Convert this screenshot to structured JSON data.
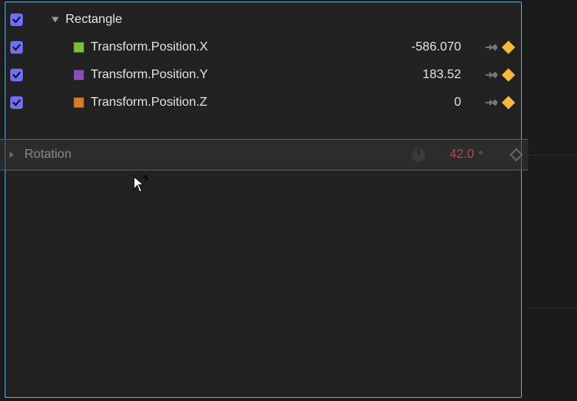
{
  "panel": {
    "group_label": "Rectangle",
    "rows": [
      {
        "swatch": "#75c13c",
        "label": "Transform.Position.X",
        "value": "-586.070"
      },
      {
        "swatch": "#8a4fb3",
        "label": "Transform.Position.Y",
        "value": "183.52"
      },
      {
        "swatch": "#d67b2c",
        "label": "Transform.Position.Z",
        "value": "0"
      }
    ]
  },
  "drag": {
    "label": "Rotation",
    "value": "42.0",
    "unit": "°"
  }
}
